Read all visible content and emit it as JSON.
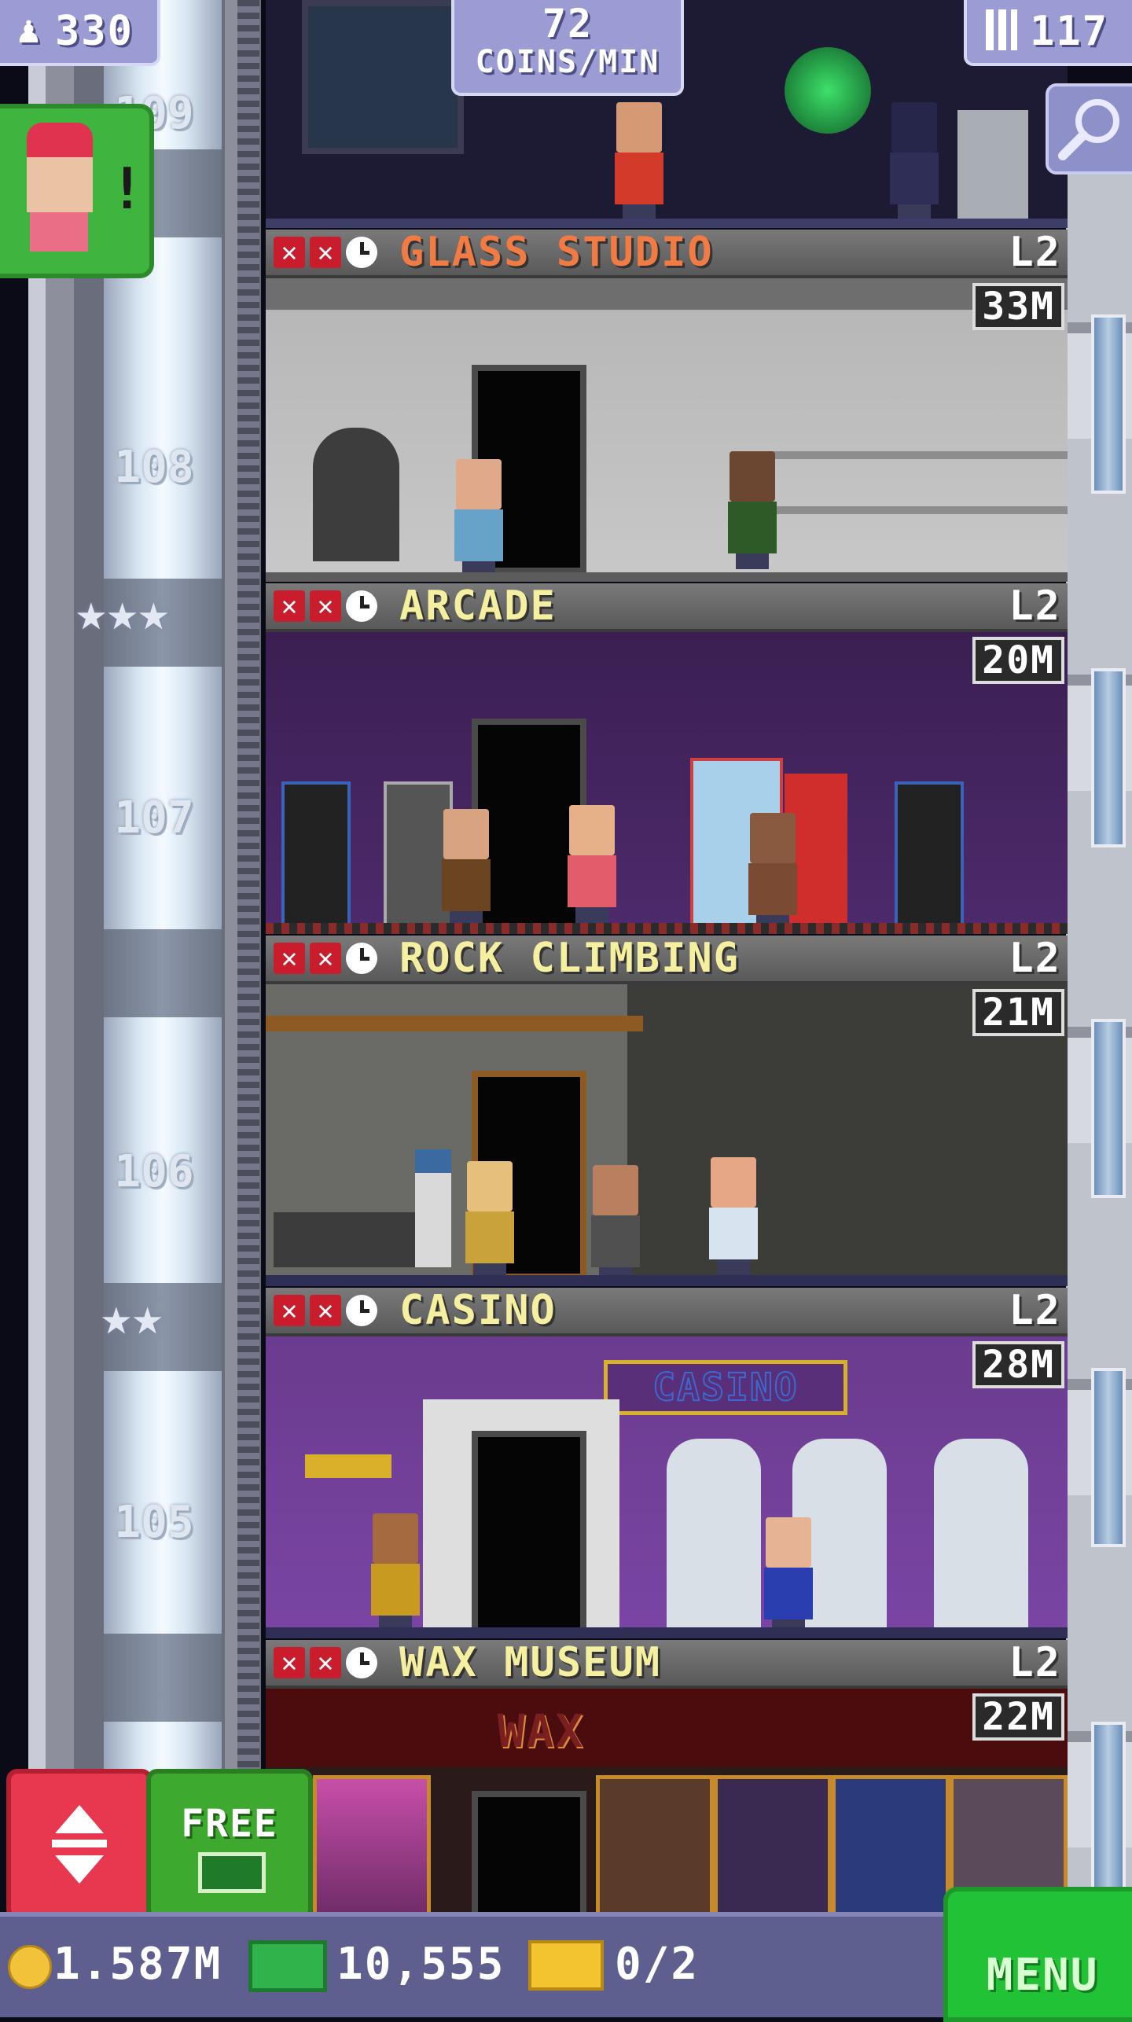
{
  "hud": {
    "population": "330",
    "coins_rate_value": "72",
    "coins_rate_unit": "COINS/MIN",
    "floor_count": "117"
  },
  "floors": [
    {
      "number": "109"
    },
    {
      "number": "108"
    },
    {
      "number": "107"
    },
    {
      "number": "106"
    },
    {
      "number": "105"
    }
  ],
  "rooms": [
    {
      "name": "GLASS STUDIO",
      "level": "L2",
      "stock": "33M"
    },
    {
      "name": "ARCADE",
      "level": "L2",
      "stock": "20M"
    },
    {
      "name": "ROCK CLIMBING",
      "level": "L2",
      "stock": "21M"
    },
    {
      "name": "CASINO",
      "level": "L2",
      "stock": "28M"
    },
    {
      "name": "WAX MUSEUM",
      "level": "L2",
      "stock": "22M"
    }
  ],
  "room_signs": {
    "casino": "CASINO",
    "wax": "WAX"
  },
  "visitor_alert_mark": "!",
  "buttons": {
    "free_label": "FREE",
    "menu_label": "MENU"
  },
  "bottom_bar": {
    "coins": "1.587M",
    "bux": "10,555",
    "tickets": "0/2"
  },
  "colors": {
    "coin": "#f2c33a",
    "bux": "#2fb34a",
    "ticket": "#f4c430",
    "alert_text": "#f27a43",
    "room_text": "#f5f0a0"
  }
}
